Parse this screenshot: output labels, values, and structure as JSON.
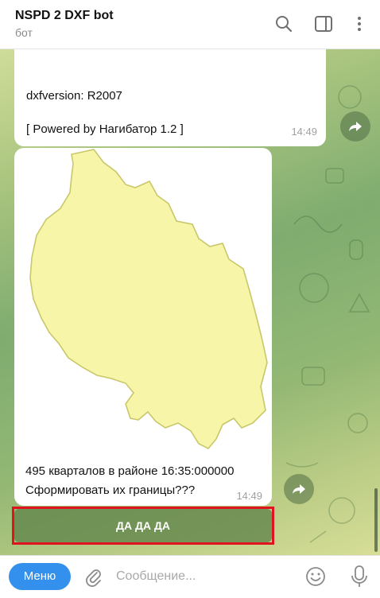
{
  "header": {
    "title": "NSPD 2 DXF bot",
    "subtitle": "бот"
  },
  "icons": {
    "search": "search-icon",
    "sidebar": "sidebar-toggle-icon",
    "more": "more-vert-icon",
    "forward": "forward-arrow-icon",
    "attach": "paperclip-icon",
    "emoji": "emoji-icon",
    "mic": "microphone-icon"
  },
  "messages": [
    {
      "line1": "dxfversion: R2007",
      "line2": "[ Powered by Нагибатор 1.2 ]",
      "time": "14:49"
    },
    {
      "line1": "495 кварталов в районе 16:35:000000",
      "line2": "Сформировать их границы???",
      "time": "14:49"
    }
  ],
  "inline_button": {
    "label": "ДА ДА ДА"
  },
  "composer": {
    "menu_label": "Меню",
    "placeholder": "Сообщение..."
  },
  "colors": {
    "accent": "#3390ec",
    "highlight": "#e0141e",
    "map_fill": "#f7f5a8"
  }
}
